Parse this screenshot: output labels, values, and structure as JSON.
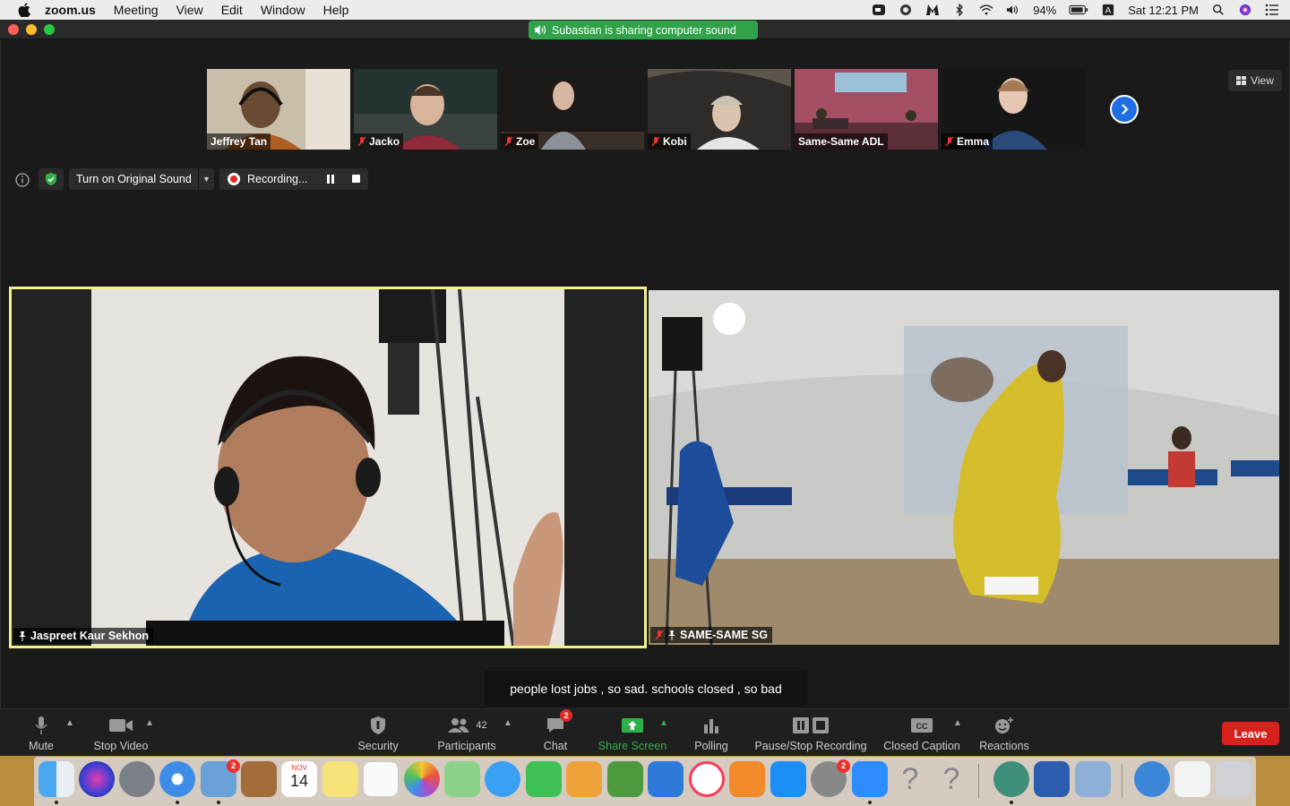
{
  "menubar": {
    "app_name": "zoom.us",
    "items": [
      "Meeting",
      "View",
      "Edit",
      "Window",
      "Help"
    ],
    "battery": "94%",
    "clock": "Sat 12:21 PM"
  },
  "window": {
    "sharing_banner": "Subastian is sharing computer sound"
  },
  "thumbnails": [
    {
      "name": "Jeffrey Tan",
      "muted": false,
      "bg": "#b8a890"
    },
    {
      "name": "Jacko",
      "muted": true,
      "bg": "#2e3a36"
    },
    {
      "name": "Zoe",
      "muted": true,
      "bg": "#201c1a"
    },
    {
      "name": "Kobi",
      "muted": true,
      "bg": "#3a3632"
    },
    {
      "name": "Same-Same ADL",
      "muted": false,
      "bg": "#8e4654"
    },
    {
      "name": "Emma",
      "muted": true,
      "bg": "#202020"
    }
  ],
  "view_button": "View",
  "controls": {
    "original_sound": "Turn on Original Sound",
    "recording": "Recording..."
  },
  "videos": {
    "left_name": "Jaspreet Kaur Sekhon",
    "right_name": "SAME-SAME SG"
  },
  "caption_text": "people lost jobs , so sad.  schools closed , so bad",
  "toolbar": {
    "mute": "Mute",
    "stop_video": "Stop Video",
    "security": "Security",
    "participants": "Participants",
    "participants_count": "42",
    "chat": "Chat",
    "chat_badge": "2",
    "share_screen": "Share Screen",
    "polling": "Polling",
    "pause_stop_recording": "Pause/Stop Recording",
    "closed_caption": "Closed Caption",
    "reactions": "Reactions",
    "leave": "Leave"
  },
  "dock": {
    "calendar_month": "NOV",
    "calendar_day": "14",
    "mail_badge": "2",
    "prefs_badge": "2",
    "accent": "#1d6fe3"
  }
}
